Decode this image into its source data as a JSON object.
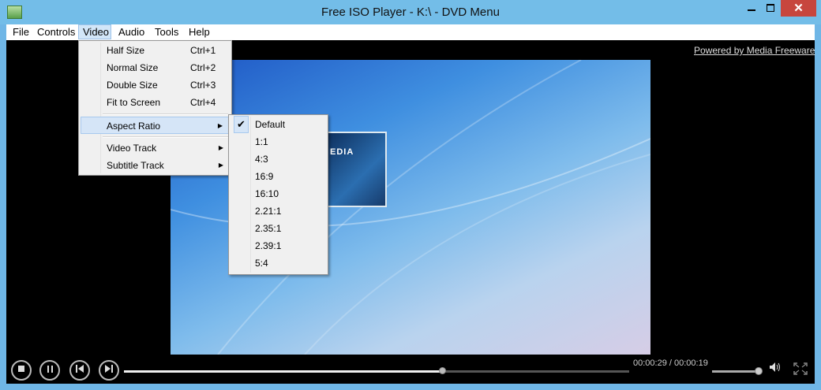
{
  "window": {
    "title": "Free ISO Player - K:\\ - DVD Menu",
    "close_glyph": "✕"
  },
  "menubar": [
    "File",
    "Controls",
    "Video",
    "Audio",
    "Tools",
    "Help"
  ],
  "video_menu": {
    "items": [
      {
        "label": "Half Size",
        "shortcut": "Ctrl+1"
      },
      {
        "label": "Normal Size",
        "shortcut": "Ctrl+2"
      },
      {
        "label": "Double Size",
        "shortcut": "Ctrl+3"
      },
      {
        "label": "Fit to Screen",
        "shortcut": "Ctrl+4"
      },
      {
        "label": "Aspect Ratio",
        "has_submenu": true,
        "highlighted": true
      },
      {
        "label": "Video Track",
        "has_submenu": true
      },
      {
        "label": "Subtitle Track",
        "has_submenu": true
      }
    ]
  },
  "aspect_ratio_menu": {
    "items": [
      "Default",
      "1:1",
      "4:3",
      "16:9",
      "16:10",
      "2.21:1",
      "2.35:1",
      "2.39:1",
      "5:4"
    ],
    "checked": "Default",
    "check_glyph": "✔"
  },
  "player": {
    "powered_by": "Powered by Media Freeware",
    "thumbnail_text": "EDIA",
    "time": "00:00:29 / 00:00:19",
    "progress": 0.63,
    "volume": 0.95
  },
  "icons": {
    "stop": "stop-icon",
    "pause": "pause-icon",
    "previous": "previous-icon",
    "next": "next-icon",
    "volume": "speaker-icon",
    "fullscreen": "fullscreen-icon"
  }
}
